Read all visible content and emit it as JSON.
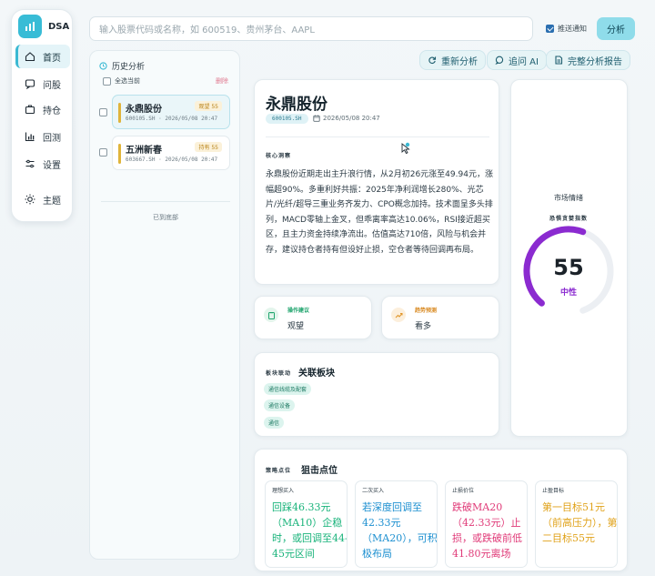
{
  "app": {
    "brand": "DSA",
    "colors": {
      "accent": "#38bcd6",
      "warning": "#e0b43a",
      "purple": "#8b2bd0"
    }
  },
  "nav": {
    "items": [
      {
        "label": "首页",
        "icon": "home-icon",
        "active": true
      },
      {
        "label": "问股",
        "icon": "chat-icon",
        "active": false
      },
      {
        "label": "持仓",
        "icon": "briefcase-icon",
        "active": false
      },
      {
        "label": "回测",
        "icon": "bar-chart-icon",
        "active": false
      },
      {
        "label": "设置",
        "icon": "sliders-icon",
        "active": false
      },
      {
        "label": "主题",
        "icon": "sun-icon",
        "active": false
      }
    ]
  },
  "search": {
    "placeholder": "输入股票代码或名称，如 600519、贵州茅台、AAPL"
  },
  "push": {
    "label": "推送通知",
    "checked": true
  },
  "analyze_button": "分析",
  "history": {
    "title": "历史分析",
    "select_all": "全选当前",
    "delete": "删除",
    "items": [
      {
        "name": "永鼎股份",
        "code": "600105.SH",
        "date": "2026/05/08 20:47",
        "tag": "观望 55",
        "selected": true
      },
      {
        "name": "五洲新春",
        "code": "603667.SH",
        "date": "2026/05/08 20:47",
        "tag": "持有 55",
        "selected": false
      }
    ],
    "end_text": "已到底部"
  },
  "actions": {
    "reanalyze": "重新分析",
    "ask_ai": "追问 AI",
    "full_report": "完整分析报告"
  },
  "summary": {
    "name": "永鼎股份",
    "code": "600105.SH",
    "date": "2026/05/08 20:47",
    "core_label": "核心洞察",
    "core_text": "永鼎股份近期走出主升浪行情，从2月初26元涨至49.94元，涨幅超90%。多重利好共振：2025年净利润增长280%、光芯片/光纤/超导三重业务齐发力、CPO概念加持。技术面呈多头排列，MACD零轴上金叉，但乖离率高达10.06%，RSI接近超买区，且主力资金持续净流出。估值高达710倍，风险与机会并存，建议持仓者持有但设好止损，空仓者等待回调再布局。"
  },
  "operation": {
    "label": "操作建议",
    "value": "观望"
  },
  "trend": {
    "label": "趋势预测",
    "value": "看多"
  },
  "sector": {
    "sub": "板块联动",
    "title": "关联板块",
    "tags": [
      "通信线缆及配套",
      "通信设备",
      "通信"
    ]
  },
  "sentiment": {
    "title": "市场情绪",
    "sub": "恐惧贪婪指数",
    "score": "55",
    "score_value": 55,
    "label": "中性"
  },
  "sniper": {
    "sub": "策略点位",
    "title": "狙击点位",
    "points": [
      {
        "label": "理想买入",
        "text": "回踩46.33元（MA10）企稳时，或回调至44-45元区间",
        "color": "#18b37a"
      },
      {
        "label": "二次买入",
        "text": "若深度回调至42.33元（MA20），可积极布局",
        "color": "#1c8fd0"
      },
      {
        "label": "止损价位",
        "text": "跌破MA20（42.33元）止损，或跌破前低41.80元离场",
        "color": "#e03a78"
      },
      {
        "label": "止盈目标",
        "text": "第一目标51元（前高压力），第二目标55元",
        "color": "#e0a21a"
      }
    ]
  }
}
